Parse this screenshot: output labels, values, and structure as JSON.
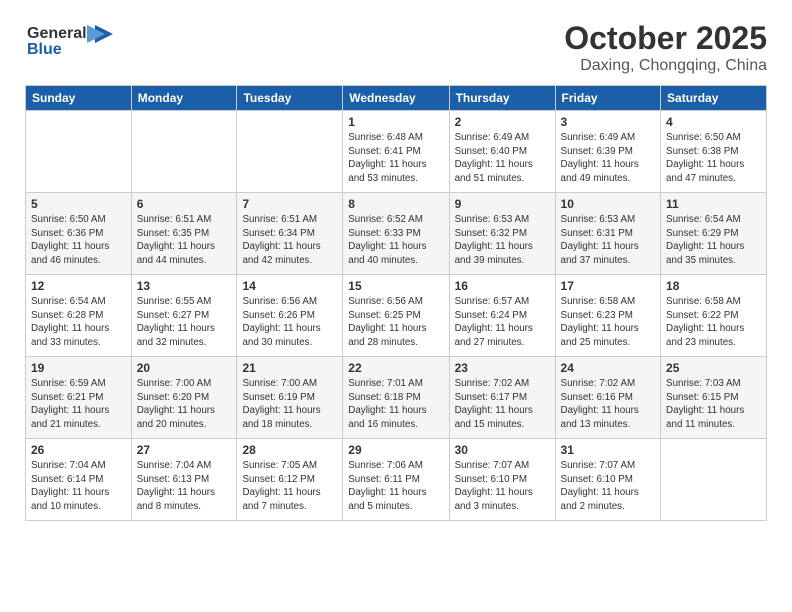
{
  "logo": {
    "line1": "General",
    "line2": "Blue"
  },
  "title": "October 2025",
  "subtitle": "Daxing, Chongqing, China",
  "weekdays": [
    "Sunday",
    "Monday",
    "Tuesday",
    "Wednesday",
    "Thursday",
    "Friday",
    "Saturday"
  ],
  "weeks": [
    [
      {
        "day": "",
        "info": ""
      },
      {
        "day": "",
        "info": ""
      },
      {
        "day": "",
        "info": ""
      },
      {
        "day": "1",
        "info": "Sunrise: 6:48 AM\nSunset: 6:41 PM\nDaylight: 11 hours\nand 53 minutes."
      },
      {
        "day": "2",
        "info": "Sunrise: 6:49 AM\nSunset: 6:40 PM\nDaylight: 11 hours\nand 51 minutes."
      },
      {
        "day": "3",
        "info": "Sunrise: 6:49 AM\nSunset: 6:39 PM\nDaylight: 11 hours\nand 49 minutes."
      },
      {
        "day": "4",
        "info": "Sunrise: 6:50 AM\nSunset: 6:38 PM\nDaylight: 11 hours\nand 47 minutes."
      }
    ],
    [
      {
        "day": "5",
        "info": "Sunrise: 6:50 AM\nSunset: 6:36 PM\nDaylight: 11 hours\nand 46 minutes."
      },
      {
        "day": "6",
        "info": "Sunrise: 6:51 AM\nSunset: 6:35 PM\nDaylight: 11 hours\nand 44 minutes."
      },
      {
        "day": "7",
        "info": "Sunrise: 6:51 AM\nSunset: 6:34 PM\nDaylight: 11 hours\nand 42 minutes."
      },
      {
        "day": "8",
        "info": "Sunrise: 6:52 AM\nSunset: 6:33 PM\nDaylight: 11 hours\nand 40 minutes."
      },
      {
        "day": "9",
        "info": "Sunrise: 6:53 AM\nSunset: 6:32 PM\nDaylight: 11 hours\nand 39 minutes."
      },
      {
        "day": "10",
        "info": "Sunrise: 6:53 AM\nSunset: 6:31 PM\nDaylight: 11 hours\nand 37 minutes."
      },
      {
        "day": "11",
        "info": "Sunrise: 6:54 AM\nSunset: 6:29 PM\nDaylight: 11 hours\nand 35 minutes."
      }
    ],
    [
      {
        "day": "12",
        "info": "Sunrise: 6:54 AM\nSunset: 6:28 PM\nDaylight: 11 hours\nand 33 minutes."
      },
      {
        "day": "13",
        "info": "Sunrise: 6:55 AM\nSunset: 6:27 PM\nDaylight: 11 hours\nand 32 minutes."
      },
      {
        "day": "14",
        "info": "Sunrise: 6:56 AM\nSunset: 6:26 PM\nDaylight: 11 hours\nand 30 minutes."
      },
      {
        "day": "15",
        "info": "Sunrise: 6:56 AM\nSunset: 6:25 PM\nDaylight: 11 hours\nand 28 minutes."
      },
      {
        "day": "16",
        "info": "Sunrise: 6:57 AM\nSunset: 6:24 PM\nDaylight: 11 hours\nand 27 minutes."
      },
      {
        "day": "17",
        "info": "Sunrise: 6:58 AM\nSunset: 6:23 PM\nDaylight: 11 hours\nand 25 minutes."
      },
      {
        "day": "18",
        "info": "Sunrise: 6:58 AM\nSunset: 6:22 PM\nDaylight: 11 hours\nand 23 minutes."
      }
    ],
    [
      {
        "day": "19",
        "info": "Sunrise: 6:59 AM\nSunset: 6:21 PM\nDaylight: 11 hours\nand 21 minutes."
      },
      {
        "day": "20",
        "info": "Sunrise: 7:00 AM\nSunset: 6:20 PM\nDaylight: 11 hours\nand 20 minutes."
      },
      {
        "day": "21",
        "info": "Sunrise: 7:00 AM\nSunset: 6:19 PM\nDaylight: 11 hours\nand 18 minutes."
      },
      {
        "day": "22",
        "info": "Sunrise: 7:01 AM\nSunset: 6:18 PM\nDaylight: 11 hours\nand 16 minutes."
      },
      {
        "day": "23",
        "info": "Sunrise: 7:02 AM\nSunset: 6:17 PM\nDaylight: 11 hours\nand 15 minutes."
      },
      {
        "day": "24",
        "info": "Sunrise: 7:02 AM\nSunset: 6:16 PM\nDaylight: 11 hours\nand 13 minutes."
      },
      {
        "day": "25",
        "info": "Sunrise: 7:03 AM\nSunset: 6:15 PM\nDaylight: 11 hours\nand 11 minutes."
      }
    ],
    [
      {
        "day": "26",
        "info": "Sunrise: 7:04 AM\nSunset: 6:14 PM\nDaylight: 11 hours\nand 10 minutes."
      },
      {
        "day": "27",
        "info": "Sunrise: 7:04 AM\nSunset: 6:13 PM\nDaylight: 11 hours\nand 8 minutes."
      },
      {
        "day": "28",
        "info": "Sunrise: 7:05 AM\nSunset: 6:12 PM\nDaylight: 11 hours\nand 7 minutes."
      },
      {
        "day": "29",
        "info": "Sunrise: 7:06 AM\nSunset: 6:11 PM\nDaylight: 11 hours\nand 5 minutes."
      },
      {
        "day": "30",
        "info": "Sunrise: 7:07 AM\nSunset: 6:10 PM\nDaylight: 11 hours\nand 3 minutes."
      },
      {
        "day": "31",
        "info": "Sunrise: 7:07 AM\nSunset: 6:10 PM\nDaylight: 11 hours\nand 2 minutes."
      },
      {
        "day": "",
        "info": ""
      }
    ]
  ]
}
